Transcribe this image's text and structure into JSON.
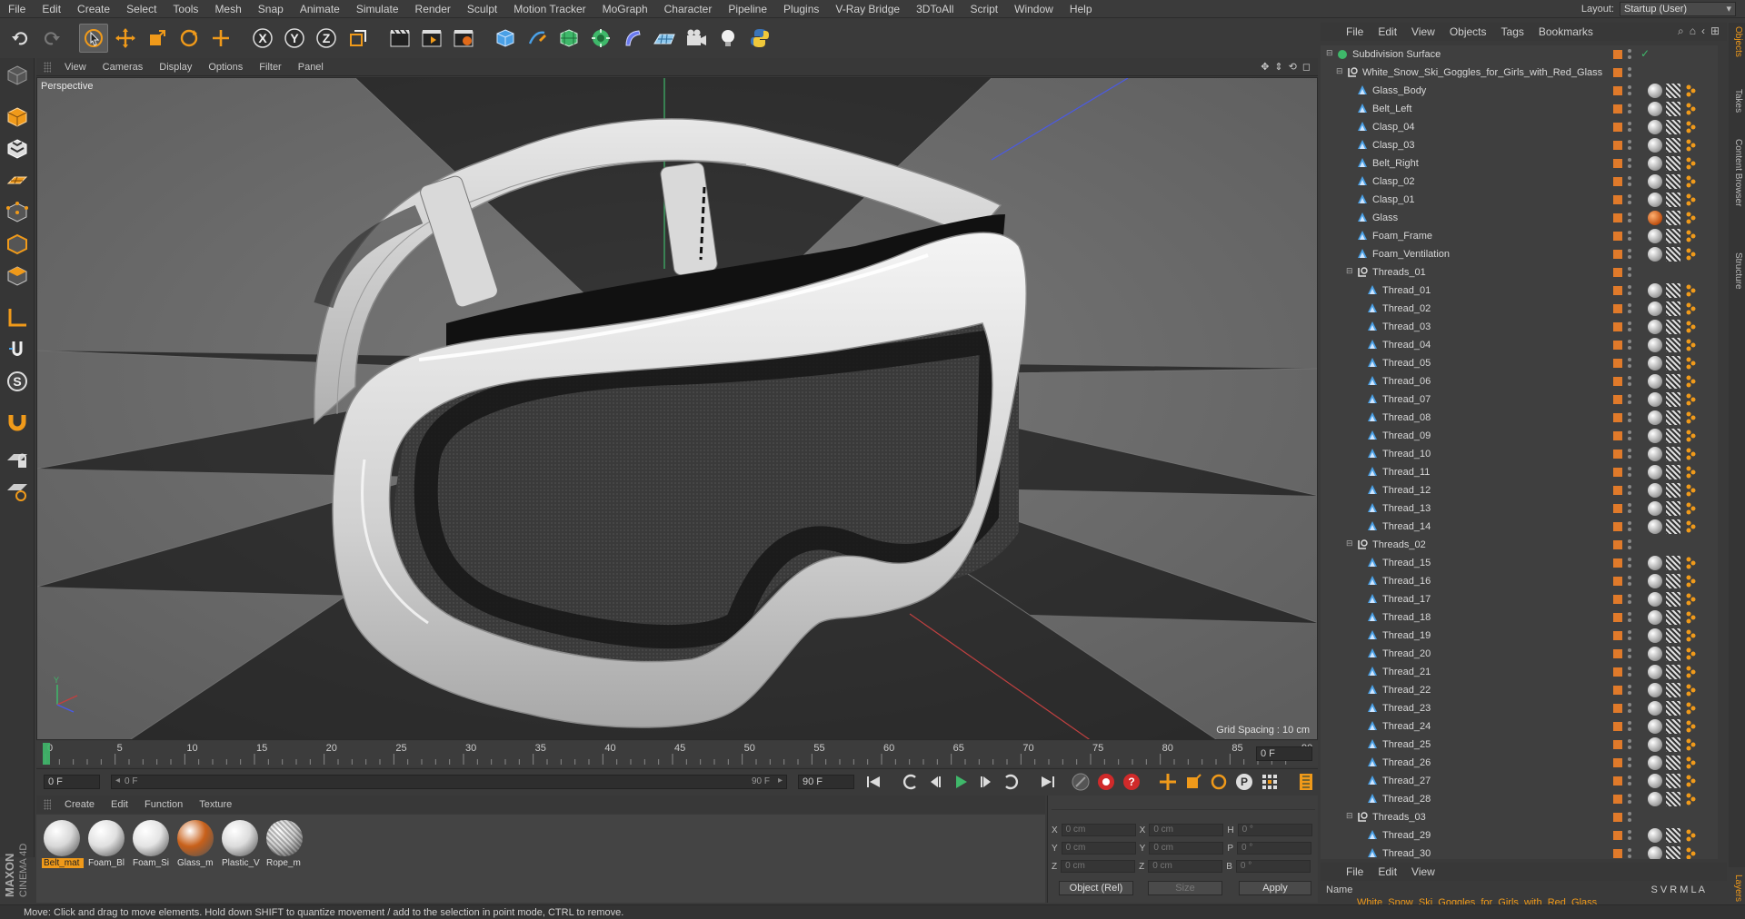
{
  "menu": [
    "File",
    "Edit",
    "Create",
    "Select",
    "Tools",
    "Mesh",
    "Snap",
    "Animate",
    "Simulate",
    "Render",
    "Sculpt",
    "Motion Tracker",
    "MoGraph",
    "Character",
    "Pipeline",
    "Plugins",
    "V-Ray Bridge",
    "3DToAll",
    "Script",
    "Window",
    "Help"
  ],
  "layout": {
    "label": "Layout:",
    "value": "Startup (User)"
  },
  "viewport": {
    "menu": [
      "View",
      "Cameras",
      "Display",
      "Options",
      "Filter",
      "Panel"
    ],
    "label": "Perspective",
    "grid_spacing": "Grid Spacing : 10 cm"
  },
  "timeline": {
    "ticks": [
      "0",
      "5",
      "10",
      "15",
      "20",
      "25",
      "30",
      "35",
      "40",
      "45",
      "50",
      "55",
      "60",
      "65",
      "70",
      "75",
      "80",
      "85",
      "90"
    ],
    "current_frame": "0 F",
    "start_frame": "0 F",
    "slider_start": "0 F",
    "slider_end": "90 F",
    "end_frame": "90 F"
  },
  "materials": {
    "menu": [
      "Create",
      "Edit",
      "Function",
      "Texture"
    ],
    "items": [
      {
        "name": "Belt_mat",
        "color": "#d8d8d8"
      },
      {
        "name": "Foam_Bl",
        "color": "#e0e0e0"
      },
      {
        "name": "Foam_Si",
        "color": "#e4e4e4"
      },
      {
        "name": "Glass_m",
        "color": "#c8601a"
      },
      {
        "name": "Plastic_V",
        "color": "#dcdcdc"
      },
      {
        "name": "Rope_m",
        "color": "#cfcfcf"
      }
    ]
  },
  "coords": {
    "x_pos": "0 cm",
    "y_pos": "0 cm",
    "z_pos": "0 cm",
    "x_size": "0 cm",
    "y_size": "0 cm",
    "z_size": "0 cm",
    "h": "0 °",
    "p": "0 °",
    "b": "0 °",
    "mode": "Object (Rel)",
    "size_mode": "Size",
    "apply": "Apply",
    "labels": {
      "x": "X",
      "y": "Y",
      "z": "Z",
      "h": "H",
      "p": "P",
      "b": "B"
    }
  },
  "object_manager": {
    "menu": [
      "File",
      "Edit",
      "View",
      "Objects",
      "Tags",
      "Bookmarks"
    ],
    "rows": [
      {
        "name": "Subdivision Surface",
        "level": 0,
        "type": "subdiv"
      },
      {
        "name": "White_Snow_Ski_Goggles_for_Girls_with_Red_Glass",
        "level": 1,
        "type": "null"
      },
      {
        "name": "Glass_Body",
        "level": 2,
        "type": "poly"
      },
      {
        "name": "Belt_Left",
        "level": 2,
        "type": "poly"
      },
      {
        "name": "Clasp_04",
        "level": 2,
        "type": "poly"
      },
      {
        "name": "Clasp_03",
        "level": 2,
        "type": "poly"
      },
      {
        "name": "Belt_Right",
        "level": 2,
        "type": "poly"
      },
      {
        "name": "Clasp_02",
        "level": 2,
        "type": "poly"
      },
      {
        "name": "Clasp_01",
        "level": 2,
        "type": "poly"
      },
      {
        "name": "Glass",
        "level": 2,
        "type": "poly",
        "glass": true
      },
      {
        "name": "Foam_Frame",
        "level": 2,
        "type": "poly"
      },
      {
        "name": "Foam_Ventilation",
        "level": 2,
        "type": "poly"
      },
      {
        "name": "Threads_01",
        "level": 2,
        "type": "null"
      },
      {
        "name": "Thread_01",
        "level": 3,
        "type": "poly"
      },
      {
        "name": "Thread_02",
        "level": 3,
        "type": "poly"
      },
      {
        "name": "Thread_03",
        "level": 3,
        "type": "poly"
      },
      {
        "name": "Thread_04",
        "level": 3,
        "type": "poly"
      },
      {
        "name": "Thread_05",
        "level": 3,
        "type": "poly"
      },
      {
        "name": "Thread_06",
        "level": 3,
        "type": "poly"
      },
      {
        "name": "Thread_07",
        "level": 3,
        "type": "poly"
      },
      {
        "name": "Thread_08",
        "level": 3,
        "type": "poly"
      },
      {
        "name": "Thread_09",
        "level": 3,
        "type": "poly"
      },
      {
        "name": "Thread_10",
        "level": 3,
        "type": "poly"
      },
      {
        "name": "Thread_11",
        "level": 3,
        "type": "poly"
      },
      {
        "name": "Thread_12",
        "level": 3,
        "type": "poly"
      },
      {
        "name": "Thread_13",
        "level": 3,
        "type": "poly"
      },
      {
        "name": "Thread_14",
        "level": 3,
        "type": "poly"
      },
      {
        "name": "Threads_02",
        "level": 2,
        "type": "null"
      },
      {
        "name": "Thread_15",
        "level": 3,
        "type": "poly"
      },
      {
        "name": "Thread_16",
        "level": 3,
        "type": "poly"
      },
      {
        "name": "Thread_17",
        "level": 3,
        "type": "poly"
      },
      {
        "name": "Thread_18",
        "level": 3,
        "type": "poly"
      },
      {
        "name": "Thread_19",
        "level": 3,
        "type": "poly"
      },
      {
        "name": "Thread_20",
        "level": 3,
        "type": "poly"
      },
      {
        "name": "Thread_21",
        "level": 3,
        "type": "poly"
      },
      {
        "name": "Thread_22",
        "level": 3,
        "type": "poly"
      },
      {
        "name": "Thread_23",
        "level": 3,
        "type": "poly"
      },
      {
        "name": "Thread_24",
        "level": 3,
        "type": "poly"
      },
      {
        "name": "Thread_25",
        "level": 3,
        "type": "poly"
      },
      {
        "name": "Thread_26",
        "level": 3,
        "type": "poly"
      },
      {
        "name": "Thread_27",
        "level": 3,
        "type": "poly"
      },
      {
        "name": "Thread_28",
        "level": 3,
        "type": "poly"
      },
      {
        "name": "Threads_03",
        "level": 2,
        "type": "null"
      },
      {
        "name": "Thread_29",
        "level": 3,
        "type": "poly"
      },
      {
        "name": "Thread_30",
        "level": 3,
        "type": "poly"
      }
    ]
  },
  "layer_manager": {
    "menu": [
      "File",
      "Edit",
      "View"
    ],
    "name_header": "Name",
    "columns": "S V R M L A",
    "row": "White_Snow_Ski_Goggles_for_Girls_with_Red_Glass"
  },
  "right_tabs": [
    "Objects",
    "Takes",
    "Content Browser",
    "Structure"
  ],
  "layer_tab": "Layers",
  "brand": {
    "maxon": "MAXON",
    "product": "CINEMA 4D"
  },
  "status": "Move: Click and drag to move elements. Hold down SHIFT to quantize movement / add to the selection in point mode, CTRL to remove."
}
